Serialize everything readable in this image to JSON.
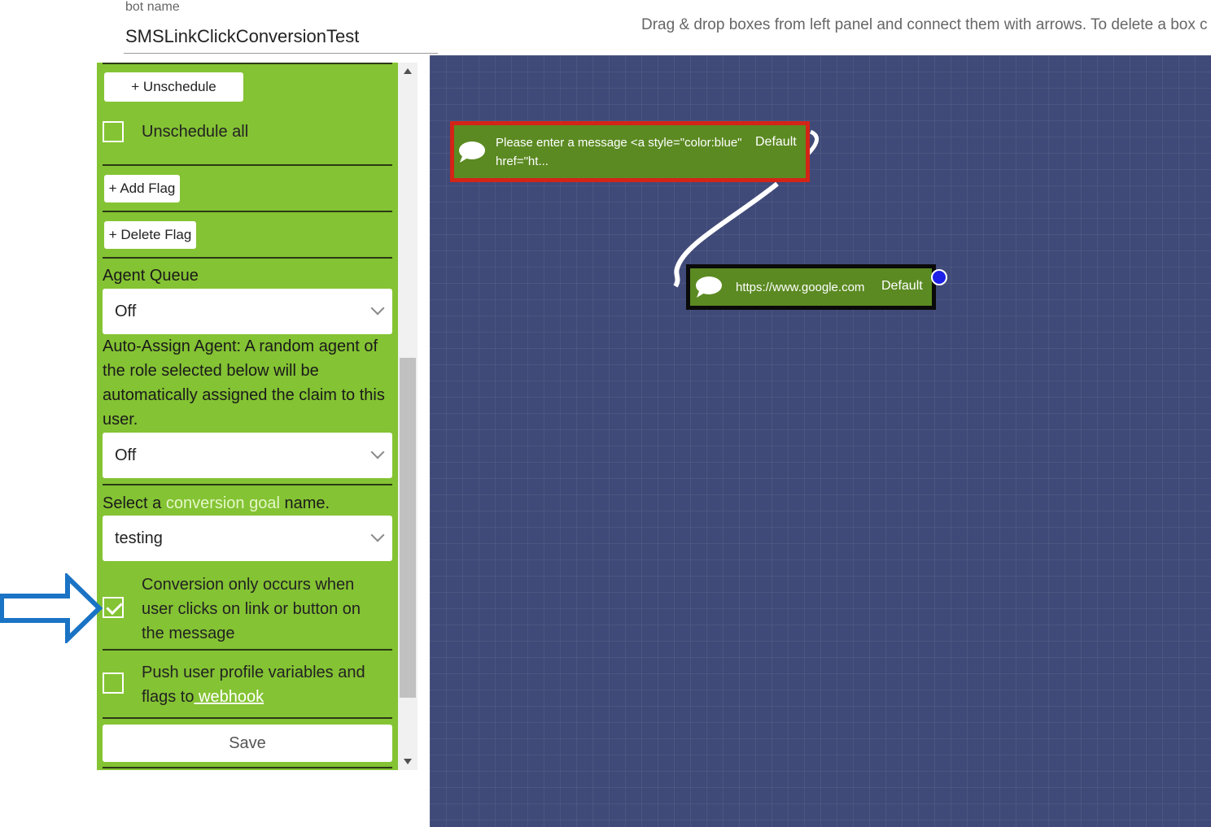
{
  "header": {
    "bot_name_label": "bot name",
    "bot_name_value": "SMSLinkClickConversionTest",
    "instructions": "Drag & drop boxes from left panel and connect them with arrows. To delete a box c"
  },
  "panel": {
    "unschedule_button": "+ Unschedule",
    "unschedule_all_label": "Unschedule all",
    "add_flag_button": "+ Add Flag",
    "delete_flag_button": "+ Delete Flag",
    "agent_queue_label": "Agent Queue",
    "agent_queue_value": "Off",
    "auto_assign_text": "Auto-Assign Agent: A random agent of the role selected below will be automatically assigned the claim to this user.",
    "auto_assign_value": "Off",
    "conversion_prefix": "Select a ",
    "conversion_link": "conversion goal",
    "conversion_suffix": " name.",
    "conversion_value": "testing",
    "conversion_click_label": "Conversion only occurs when user clicks on link or button on the message",
    "push_label_prefix": "Push user profile variables and flags to",
    "push_label_link": " webhook",
    "save_button": "Save"
  },
  "canvas": {
    "node1_message": "Please enter a message <a style=\"color:blue\" href=\"ht...",
    "node1_tag": "Default",
    "node2_message": "https://www.google.com",
    "node2_tag": "Default"
  },
  "colors": {
    "panel_green": "#84c333",
    "canvas_bg": "#404a78",
    "node_green": "#5b8a22",
    "selected_border": "#d42418",
    "port_blue": "#1d20e6",
    "annotation_arrow": "#1a73c4"
  }
}
